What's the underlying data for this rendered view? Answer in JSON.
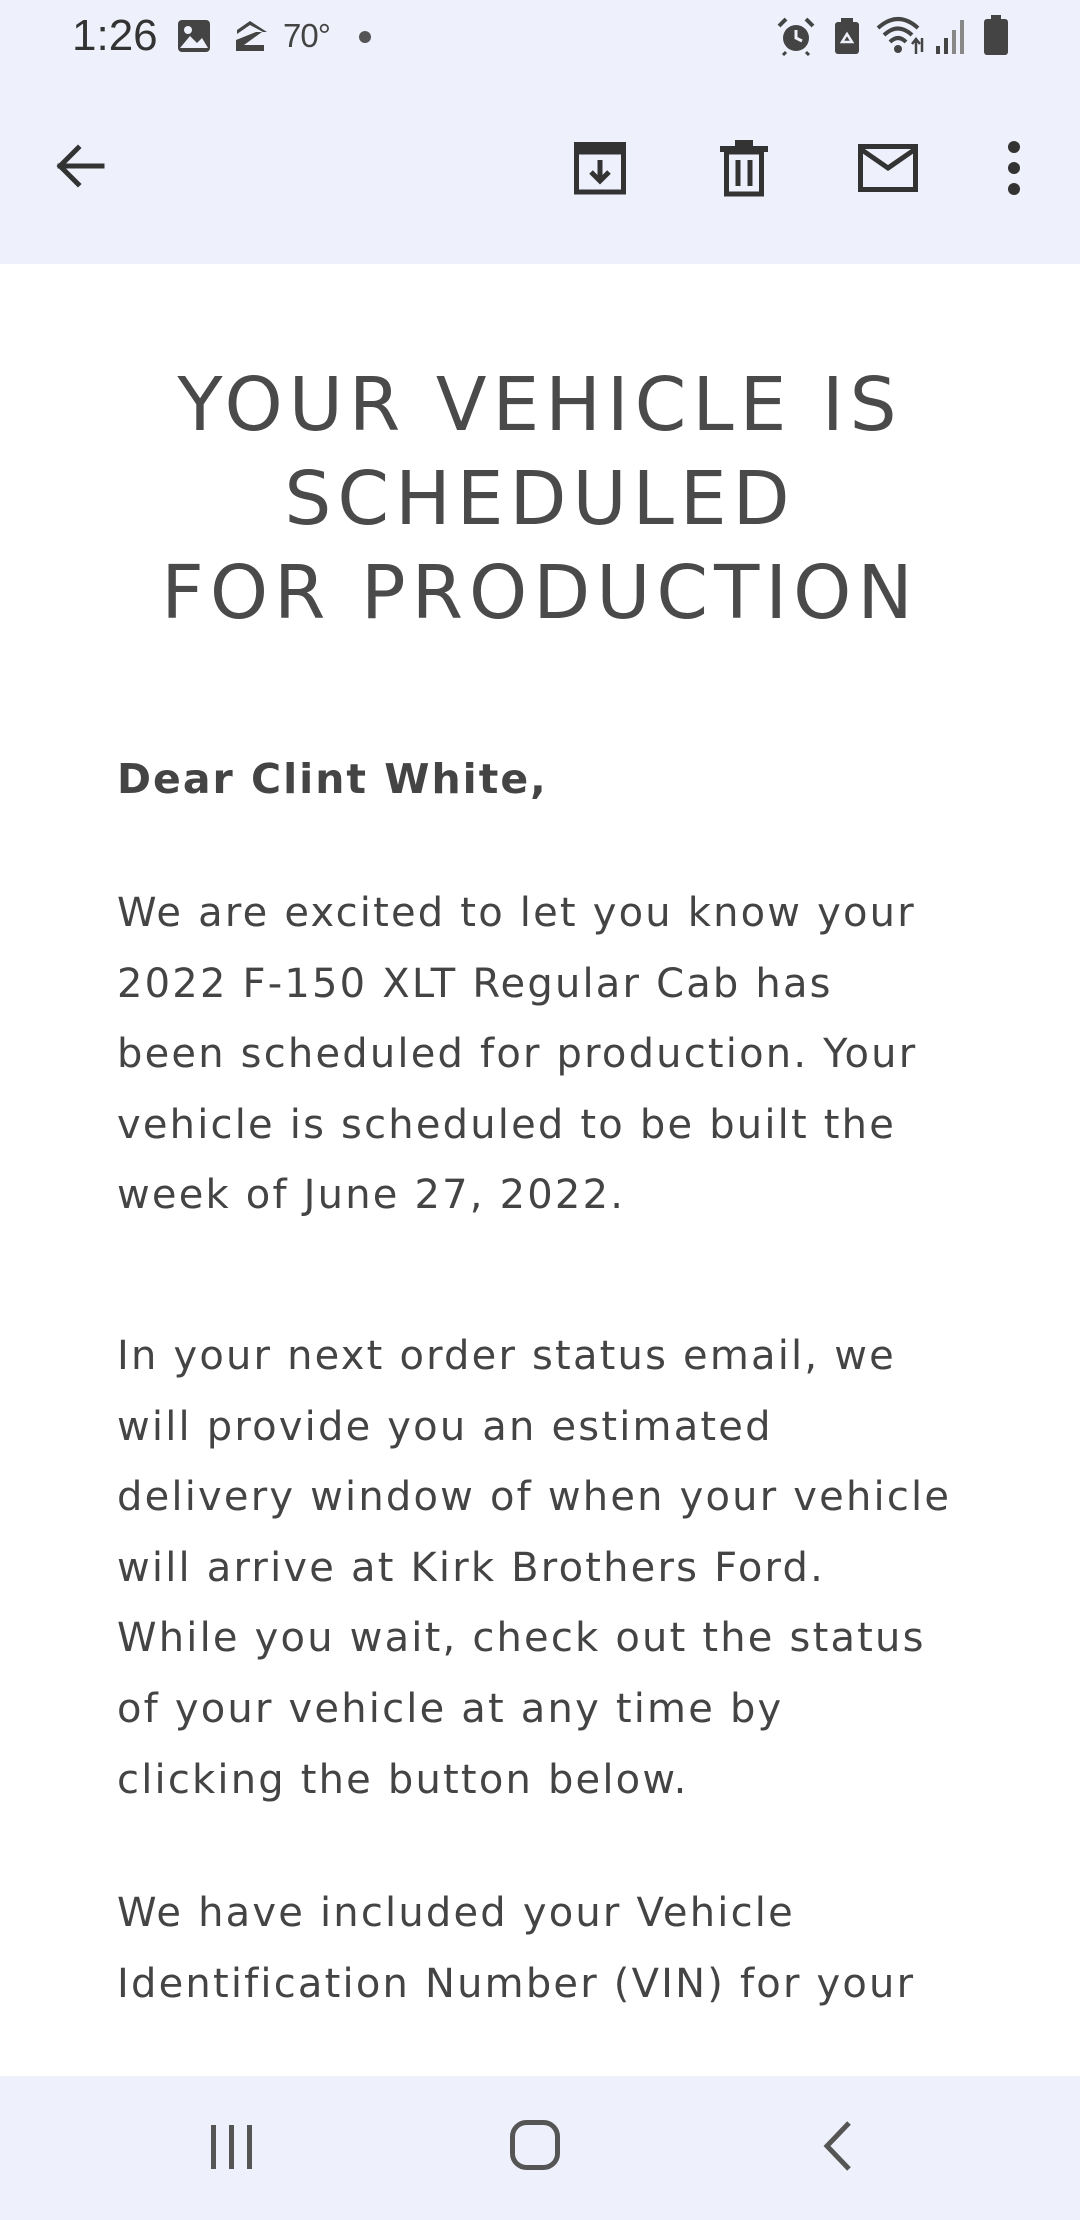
{
  "status_bar": {
    "time": "1:26",
    "temperature": "70°",
    "icons": [
      "gallery-icon",
      "zillow-icon",
      "dot-icon",
      "alarm-icon",
      "recycle-battery-icon",
      "wifi-icon",
      "signal-icon",
      "battery-icon"
    ]
  },
  "toolbar": {
    "icons": [
      "back-arrow-icon",
      "archive-icon",
      "delete-icon",
      "mark-unread-icon",
      "more-options-icon"
    ]
  },
  "email": {
    "headline_lines": [
      "YOUR VEHICLE IS",
      "SCHEDULED",
      "FOR PRODUCTION"
    ],
    "greeting": "Dear Clint White,",
    "paragraph_1": [
      "We are excited to let you know your",
      "2022 F-150 XLT Regular Cab has",
      "been scheduled for production. Your",
      "vehicle is scheduled to be built the",
      "week of June 27, 2022."
    ],
    "paragraph_2": [
      "In your next order status email, we",
      "will provide you an estimated",
      "delivery window of when your vehicle",
      "will arrive at Kirk Brothers Ford.",
      "While you wait, check out the status",
      "of your vehicle at any time by",
      "clicking the button below."
    ],
    "paragraph_3": [
      "We have included your Vehicle",
      "Identification Number (VIN) for your"
    ]
  },
  "nav_bar": {
    "icons": [
      "recent-apps-icon",
      "home-icon",
      "back-icon"
    ]
  },
  "colors": {
    "chrome_background": "#eef1fb",
    "content_background": "#ffffff",
    "text": "#444444",
    "icon": "#333333"
  }
}
